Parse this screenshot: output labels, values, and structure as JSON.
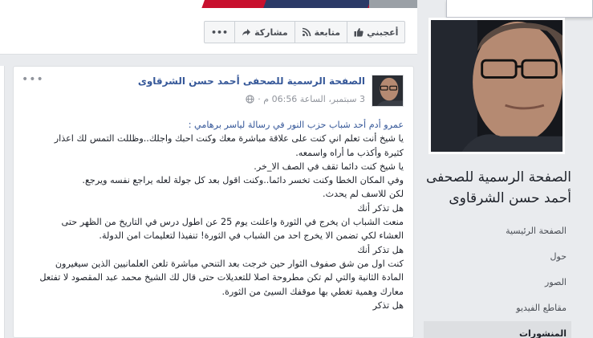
{
  "cover": {
    "colors": {
      "red": "#c8102e",
      "navy": "#2b3a67"
    }
  },
  "actions": {
    "more_label": "•••",
    "share_label": "مشاركة",
    "follow_label": "متابعة",
    "like_label": "أعجبني",
    "icons": {
      "share": "share-arrow-icon",
      "follow": "rss-icon",
      "like": "thumbs-up-icon"
    }
  },
  "sidebar": {
    "page_name": "الصفحة الرسمية للصحفى أحمد حسن الشرقاوى",
    "items": [
      {
        "label": "الصفحة الرئيسية",
        "active": false
      },
      {
        "label": "حول",
        "active": false
      },
      {
        "label": "الصور",
        "active": false
      },
      {
        "label": "مقاطع الفيديو",
        "active": false
      },
      {
        "label": "المنشورات",
        "active": true
      }
    ]
  },
  "post": {
    "more_label": "•••",
    "author": "الصفحة الرسمية للصحفى أحمد حسن الشرقاوى",
    "timestamp": "3 سبتمبر، الساعة 06:56 م ·",
    "privacy_icon": "globe-icon",
    "lines": [
      "عمرو أدم أحد شباب حزب النور في رسالة لياسر برهامي :",
      "يا شيخ أنت تعلم اني كنت على علاقة مباشرة معك وكنت احبك واجلك..وظللت التمس لك اعذار",
      "كثيرة وأكذب ما أراه واسمعه.",
      "يا شيخ كنت دائما تقف في الصف الا_خر.",
      "وفي المكان الخطا وكنت تخسر دائما..وكنت اقول بعد كل جولة لعله يراجع نفسه ويرجع.",
      "لكن للاسف لم يحدث.",
      "هل تذكر أنك",
      "منعت الشباب ان يخرج في الثورة واعلنت يوم 25 عن اطول درس في التاريخ من الظهر حتى",
      "العشاء لكي تضمن الا يخرج احد من الشباب في الثورة! تنفيذا لتعليمات امن الدولة.",
      "هل تذكر أنك",
      "كنت اول من شق صفوف الثوار حين خرجت بعد التنحي مباشرة تلعن العلمانيين الذين سيغيرون",
      "المادة الثانية والتي لم تكن مطروحة اصلا للتعديلات حتى قال لك الشيخ محمد عبد المقصود لا تفتعل",
      "معارك وهمية تغطي بها موقفك السيئ من الثورة.",
      "هل تذكر"
    ]
  }
}
